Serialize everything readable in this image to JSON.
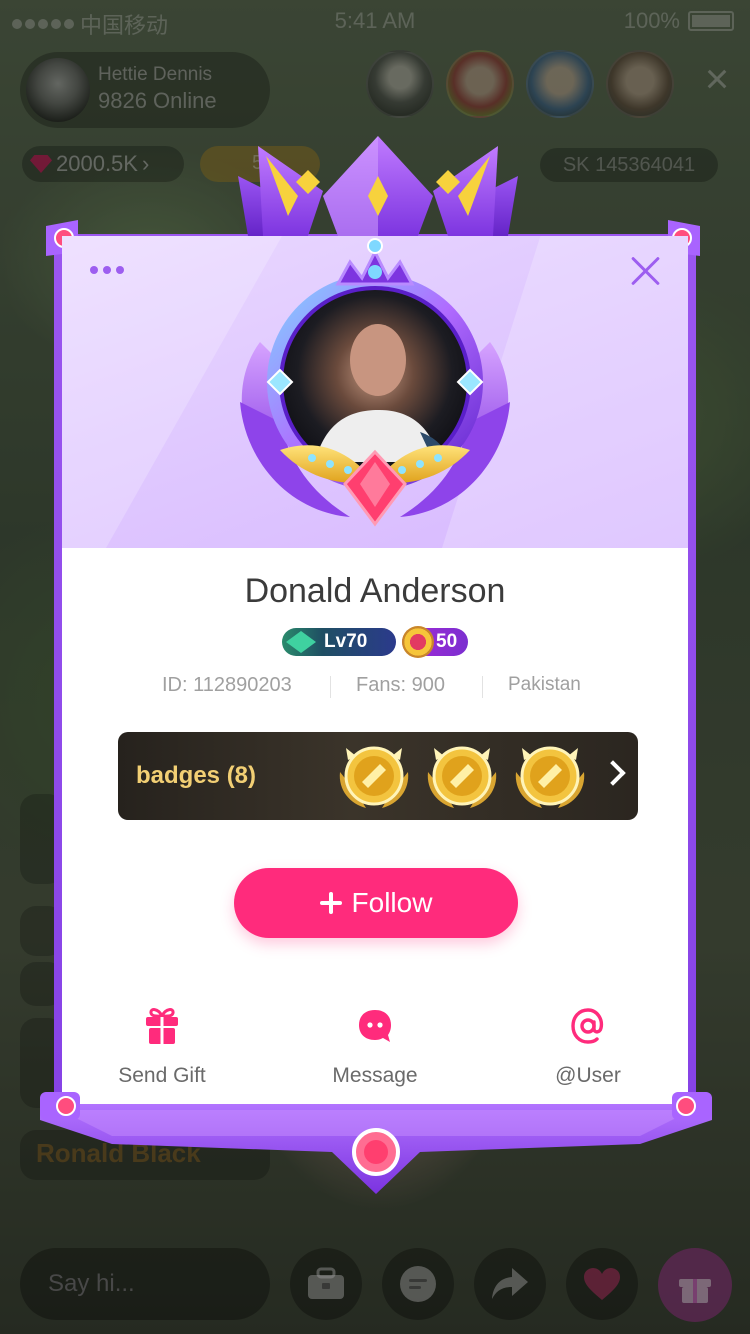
{
  "status_bar": {
    "carrier": "中国移动",
    "time": "5:41 AM",
    "battery": "100%"
  },
  "live": {
    "host_name": "Hettie Dennis",
    "online": "9826 Online",
    "diamonds": "2000.5K",
    "rank_value": "5",
    "room_id": "SK 145364041",
    "chat_name": "Ronald Black"
  },
  "dialog": {
    "user_name": "Donald Anderson",
    "level": "Lv70",
    "rank": "50",
    "id": "ID: 112890203",
    "fans": "Fans: 900",
    "country": "Pakistan",
    "badges_label": "badges (8)",
    "follow_label": "Follow",
    "actions": [
      {
        "label": "Send Gift",
        "icon": "gift-icon"
      },
      {
        "label": "Message",
        "icon": "message-icon"
      },
      {
        "label": "@User",
        "icon": "at-icon"
      }
    ]
  },
  "input": {
    "placeholder": "Say hi..."
  },
  "colors": {
    "accent": "#ff2b7c",
    "frame": "#8b47e8",
    "badge_gold": "#f2cf74"
  }
}
